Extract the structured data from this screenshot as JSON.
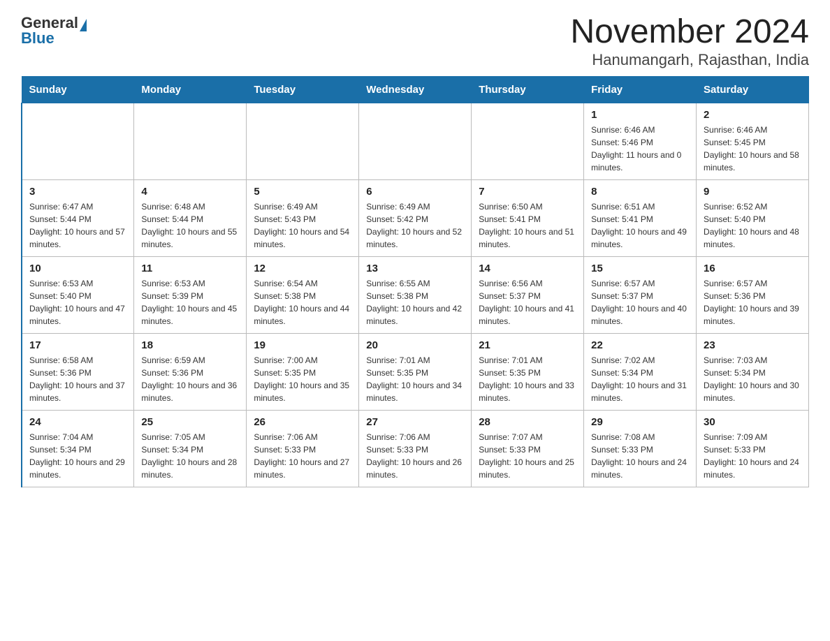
{
  "header": {
    "logo_general": "General",
    "logo_blue": "Blue",
    "title": "November 2024",
    "subtitle": "Hanumangarh, Rajasthan, India"
  },
  "days_of_week": [
    "Sunday",
    "Monday",
    "Tuesday",
    "Wednesday",
    "Thursday",
    "Friday",
    "Saturday"
  ],
  "weeks": [
    [
      {
        "day": "",
        "info": ""
      },
      {
        "day": "",
        "info": ""
      },
      {
        "day": "",
        "info": ""
      },
      {
        "day": "",
        "info": ""
      },
      {
        "day": "",
        "info": ""
      },
      {
        "day": "1",
        "info": "Sunrise: 6:46 AM\nSunset: 5:46 PM\nDaylight: 11 hours and 0 minutes."
      },
      {
        "day": "2",
        "info": "Sunrise: 6:46 AM\nSunset: 5:45 PM\nDaylight: 10 hours and 58 minutes."
      }
    ],
    [
      {
        "day": "3",
        "info": "Sunrise: 6:47 AM\nSunset: 5:44 PM\nDaylight: 10 hours and 57 minutes."
      },
      {
        "day": "4",
        "info": "Sunrise: 6:48 AM\nSunset: 5:44 PM\nDaylight: 10 hours and 55 minutes."
      },
      {
        "day": "5",
        "info": "Sunrise: 6:49 AM\nSunset: 5:43 PM\nDaylight: 10 hours and 54 minutes."
      },
      {
        "day": "6",
        "info": "Sunrise: 6:49 AM\nSunset: 5:42 PM\nDaylight: 10 hours and 52 minutes."
      },
      {
        "day": "7",
        "info": "Sunrise: 6:50 AM\nSunset: 5:41 PM\nDaylight: 10 hours and 51 minutes."
      },
      {
        "day": "8",
        "info": "Sunrise: 6:51 AM\nSunset: 5:41 PM\nDaylight: 10 hours and 49 minutes."
      },
      {
        "day": "9",
        "info": "Sunrise: 6:52 AM\nSunset: 5:40 PM\nDaylight: 10 hours and 48 minutes."
      }
    ],
    [
      {
        "day": "10",
        "info": "Sunrise: 6:53 AM\nSunset: 5:40 PM\nDaylight: 10 hours and 47 minutes."
      },
      {
        "day": "11",
        "info": "Sunrise: 6:53 AM\nSunset: 5:39 PM\nDaylight: 10 hours and 45 minutes."
      },
      {
        "day": "12",
        "info": "Sunrise: 6:54 AM\nSunset: 5:38 PM\nDaylight: 10 hours and 44 minutes."
      },
      {
        "day": "13",
        "info": "Sunrise: 6:55 AM\nSunset: 5:38 PM\nDaylight: 10 hours and 42 minutes."
      },
      {
        "day": "14",
        "info": "Sunrise: 6:56 AM\nSunset: 5:37 PM\nDaylight: 10 hours and 41 minutes."
      },
      {
        "day": "15",
        "info": "Sunrise: 6:57 AM\nSunset: 5:37 PM\nDaylight: 10 hours and 40 minutes."
      },
      {
        "day": "16",
        "info": "Sunrise: 6:57 AM\nSunset: 5:36 PM\nDaylight: 10 hours and 39 minutes."
      }
    ],
    [
      {
        "day": "17",
        "info": "Sunrise: 6:58 AM\nSunset: 5:36 PM\nDaylight: 10 hours and 37 minutes."
      },
      {
        "day": "18",
        "info": "Sunrise: 6:59 AM\nSunset: 5:36 PM\nDaylight: 10 hours and 36 minutes."
      },
      {
        "day": "19",
        "info": "Sunrise: 7:00 AM\nSunset: 5:35 PM\nDaylight: 10 hours and 35 minutes."
      },
      {
        "day": "20",
        "info": "Sunrise: 7:01 AM\nSunset: 5:35 PM\nDaylight: 10 hours and 34 minutes."
      },
      {
        "day": "21",
        "info": "Sunrise: 7:01 AM\nSunset: 5:35 PM\nDaylight: 10 hours and 33 minutes."
      },
      {
        "day": "22",
        "info": "Sunrise: 7:02 AM\nSunset: 5:34 PM\nDaylight: 10 hours and 31 minutes."
      },
      {
        "day": "23",
        "info": "Sunrise: 7:03 AM\nSunset: 5:34 PM\nDaylight: 10 hours and 30 minutes."
      }
    ],
    [
      {
        "day": "24",
        "info": "Sunrise: 7:04 AM\nSunset: 5:34 PM\nDaylight: 10 hours and 29 minutes."
      },
      {
        "day": "25",
        "info": "Sunrise: 7:05 AM\nSunset: 5:34 PM\nDaylight: 10 hours and 28 minutes."
      },
      {
        "day": "26",
        "info": "Sunrise: 7:06 AM\nSunset: 5:33 PM\nDaylight: 10 hours and 27 minutes."
      },
      {
        "day": "27",
        "info": "Sunrise: 7:06 AM\nSunset: 5:33 PM\nDaylight: 10 hours and 26 minutes."
      },
      {
        "day": "28",
        "info": "Sunrise: 7:07 AM\nSunset: 5:33 PM\nDaylight: 10 hours and 25 minutes."
      },
      {
        "day": "29",
        "info": "Sunrise: 7:08 AM\nSunset: 5:33 PM\nDaylight: 10 hours and 24 minutes."
      },
      {
        "day": "30",
        "info": "Sunrise: 7:09 AM\nSunset: 5:33 PM\nDaylight: 10 hours and 24 minutes."
      }
    ]
  ]
}
